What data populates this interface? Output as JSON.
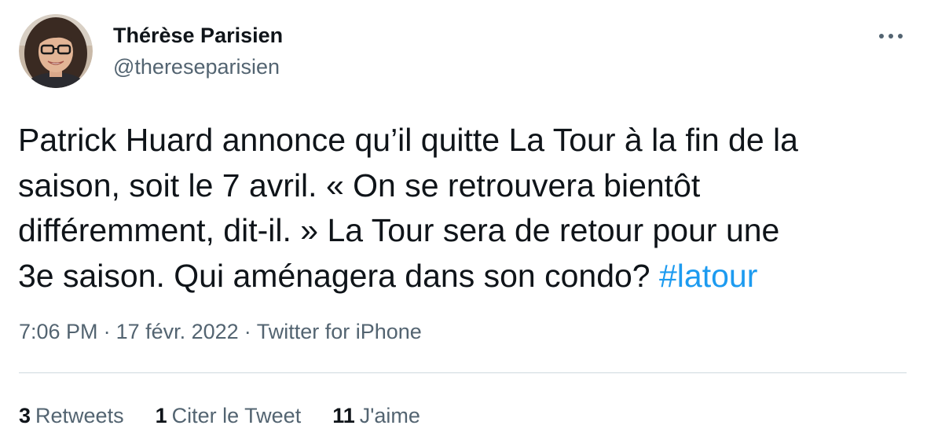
{
  "author": {
    "display_name": "Thérèse Parisien",
    "handle": "@thereseparisien",
    "avatar_icon": "profile-photo"
  },
  "menu": {
    "icon": "more-options-icon"
  },
  "tweet": {
    "lines": [
      "Patrick Huard annonce qu’il quitte La Tour à la fin de la",
      "saison, soit le 7 avril. « On se retrouvera bientôt",
      "différemment, dit-il. » La Tour sera de retour pour une"
    ],
    "last_line_text": "3e saison. Qui aménagera dans son condo? ",
    "hashtag": "#latour",
    "hashtag_color": "#1d9bf0"
  },
  "meta": {
    "time": "7:06 PM",
    "separator": "·",
    "date": "17 févr. 2022",
    "source": "Twitter for iPhone"
  },
  "stats": {
    "retweets": {
      "count": "3",
      "label": "Retweets"
    },
    "quotes": {
      "count": "1",
      "label": "Citer le Tweet"
    },
    "likes": {
      "count": "11",
      "label": "J'aime"
    }
  },
  "colors": {
    "text_primary": "#0f1419",
    "text_secondary": "#536471",
    "link": "#1d9bf0",
    "divider": "#cfd9de"
  }
}
